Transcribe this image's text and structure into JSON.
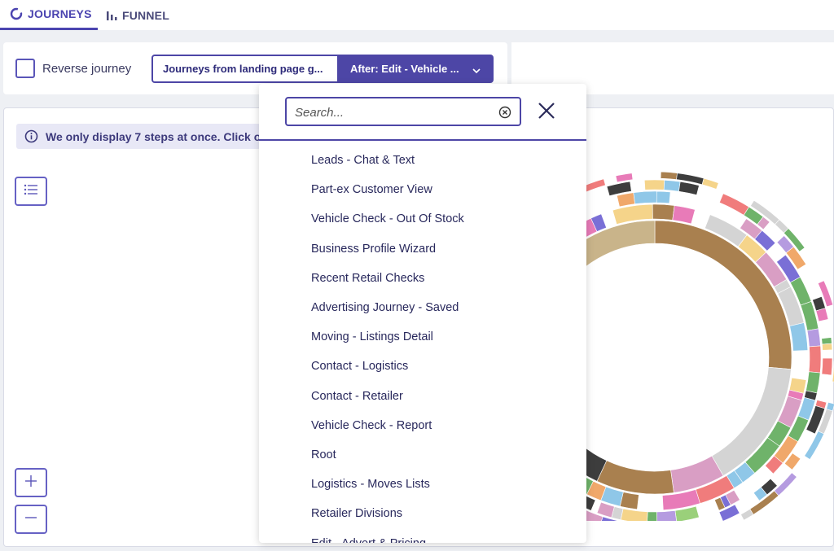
{
  "tabs": [
    {
      "label": "JOURNEYS",
      "icon": "circle-spinner-icon",
      "active": true
    },
    {
      "label": "FUNNEL",
      "icon": "bar-chart-icon",
      "active": false
    }
  ],
  "toolbar": {
    "reverse_label": "Reverse journey",
    "reverse_checked": false,
    "segment_left": "Journeys from landing page g...",
    "segment_right": "After: Edit - Vehicle ..."
  },
  "info": {
    "text": "We only display 7 steps at once. Click o"
  },
  "search": {
    "placeholder": "Search...",
    "value": ""
  },
  "options": [
    "Leads - Chat & Text",
    "Part-ex Customer View",
    "Vehicle Check - Out Of Stock",
    "Business Profile Wizard",
    "Recent Retail Checks",
    "Advertising Journey - Saved",
    "Moving - Listings Detail",
    "Contact - Logistics",
    "Contact - Retailer",
    "Vehicle Check - Report",
    "Root",
    "Logistics - Moves Lists",
    "Retailer Divisions",
    "Edit - Advert & Pricing"
  ],
  "colors": {
    "accent": "#4d46a6",
    "core": "#4a44ad",
    "ring_gray": "#d4d4d4",
    "ring_brown": "#a9804f",
    "ring_pink": "#d99ec4",
    "ring_dark": "#3d3d3d"
  }
}
